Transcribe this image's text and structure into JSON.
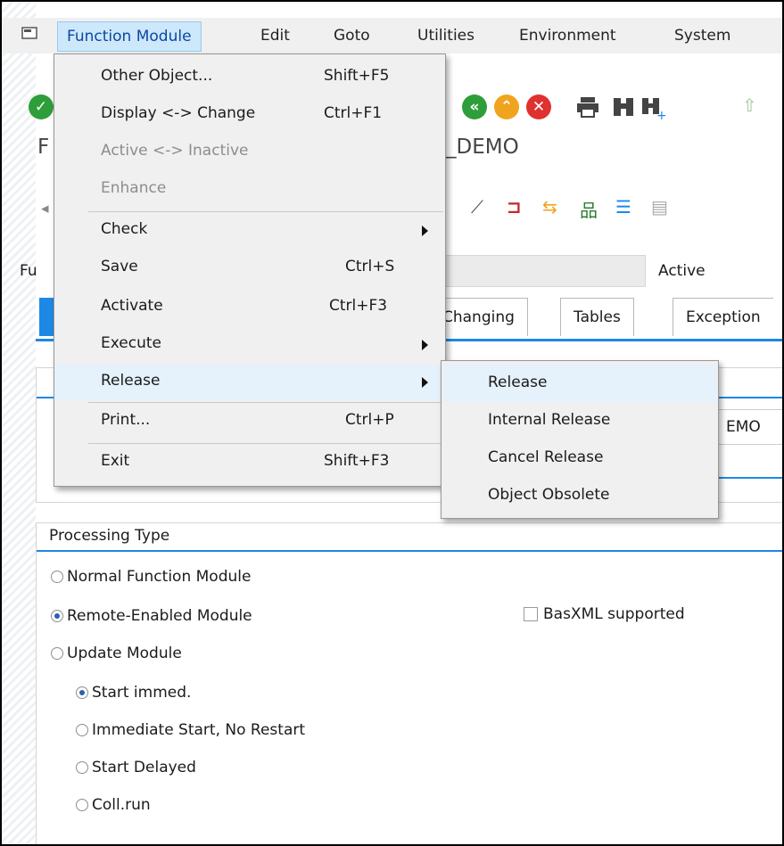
{
  "menubar": {
    "items": [
      {
        "label": "Function Module"
      },
      {
        "label": "Edit"
      },
      {
        "label": "Goto"
      },
      {
        "label": "Utilities"
      },
      {
        "label": "Environment"
      },
      {
        "label": "System"
      }
    ]
  },
  "background": {
    "title_partial_left": "F",
    "title_partial_right": "_DEMO",
    "field_label_partial": "Fu",
    "status_text": "Active",
    "tabs": [
      {
        "label": "Changing"
      },
      {
        "label": "Tables"
      },
      {
        "label": "Exception"
      }
    ],
    "group_field_partial": "EMO"
  },
  "function_menu": {
    "items": [
      {
        "label": "Other Object...",
        "shortcut": "Shift+F5",
        "enabled": true
      },
      {
        "label": "Display <-> Change",
        "shortcut": "Ctrl+F1",
        "enabled": true
      },
      {
        "label": "Active <-> Inactive",
        "shortcut": "",
        "enabled": false
      },
      {
        "label": "Enhance",
        "shortcut": "",
        "enabled": false
      },
      {
        "label": "Check",
        "shortcut": "",
        "enabled": true,
        "submenu": true
      },
      {
        "label": "Save",
        "shortcut": "Ctrl+S",
        "enabled": true
      },
      {
        "label": "Activate",
        "shortcut": "Ctrl+F3",
        "enabled": true
      },
      {
        "label": "Execute",
        "shortcut": "",
        "enabled": true,
        "submenu": true
      },
      {
        "label": "Release",
        "shortcut": "",
        "enabled": true,
        "submenu": true,
        "highlighted": true
      },
      {
        "label": "Print...",
        "shortcut": "Ctrl+P",
        "enabled": true
      },
      {
        "label": "Exit",
        "shortcut": "Shift+F3",
        "enabled": true
      }
    ]
  },
  "release_submenu": {
    "items": [
      {
        "label": "Release",
        "highlighted": true
      },
      {
        "label": "Internal Release"
      },
      {
        "label": "Cancel Release"
      },
      {
        "label": "Object Obsolete"
      }
    ]
  },
  "processing_type": {
    "title": "Processing Type",
    "options": [
      {
        "label": "Normal Function Module",
        "selected": false
      },
      {
        "label": "Remote-Enabled Module",
        "selected": true
      },
      {
        "label": "Update Module",
        "selected": false
      }
    ],
    "update_options": [
      {
        "label": "Start immed.",
        "selected": true
      },
      {
        "label": "Immediate Start, No Restart",
        "selected": false
      },
      {
        "label": "Start Delayed",
        "selected": false
      },
      {
        "label": "Coll.run",
        "selected": false
      }
    ],
    "basxml_label": "BasXML supported",
    "basxml_checked": false
  },
  "colors": {
    "accent": "#1e88e5",
    "menu_highlight": "#e5f1fb",
    "menubar_active": "#cde8fb"
  }
}
